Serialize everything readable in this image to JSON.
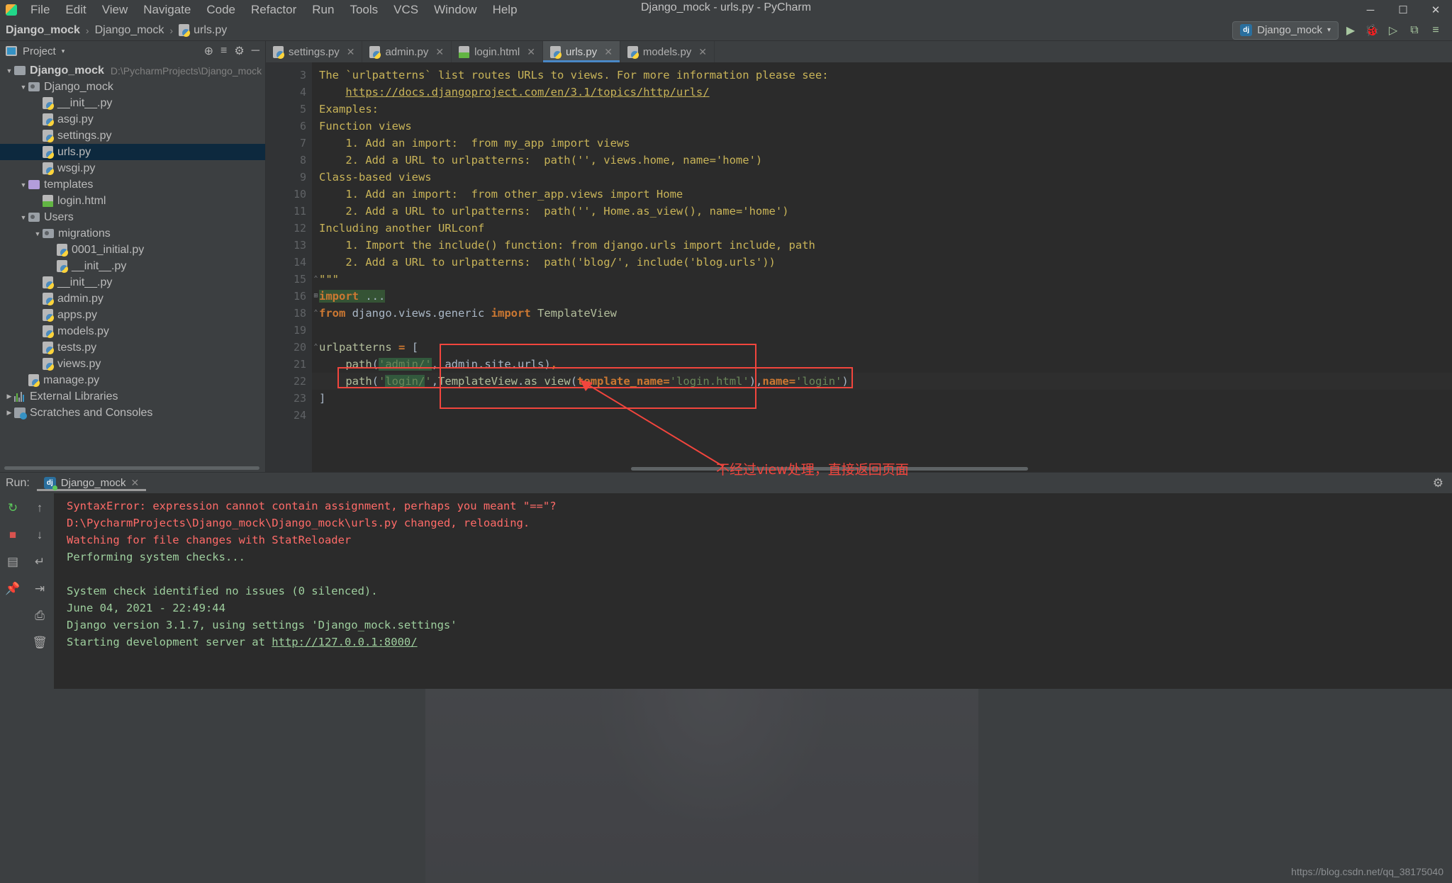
{
  "window": {
    "title": "Django_mock - urls.py - PyCharm",
    "minimize": "─",
    "maximize": "☐",
    "close": "✕"
  },
  "menu": {
    "items": [
      {
        "label": "File"
      },
      {
        "label": "Edit"
      },
      {
        "label": "View"
      },
      {
        "label": "Navigate"
      },
      {
        "label": "Code"
      },
      {
        "label": "Refactor"
      },
      {
        "label": "Run"
      },
      {
        "label": "Tools"
      },
      {
        "label": "VCS"
      },
      {
        "label": "Window"
      },
      {
        "label": "Help"
      }
    ]
  },
  "navbar": {
    "crumbs": [
      "Django_mock",
      "Django_mock",
      "urls.py"
    ],
    "separator": "›",
    "run_config": {
      "label": "Django_mock",
      "badge": "dj",
      "caret": "▾"
    },
    "buttons": [
      {
        "name": "run-button",
        "glyph": "▶"
      },
      {
        "name": "debug-button",
        "glyph": "🐞"
      },
      {
        "name": "run-coverage-button",
        "glyph": "▷"
      },
      {
        "name": "profile-button",
        "glyph": "⧉"
      },
      {
        "name": "attach-button",
        "glyph": "≡"
      }
    ]
  },
  "project_panel": {
    "title": "Project",
    "caret": "▾",
    "actions": [
      {
        "name": "locate-icon",
        "glyph": "⊕"
      },
      {
        "name": "collapse-all-icon",
        "glyph": "≡"
      },
      {
        "name": "settings-icon",
        "glyph": "⚙"
      },
      {
        "name": "hide-icon",
        "glyph": "─"
      }
    ],
    "tree": [
      {
        "indent": 0,
        "arrow": "▼",
        "icon": "folder",
        "label": "Django_mock",
        "bold": true,
        "path": "D:\\PycharmProjects\\Django_mock",
        "selected": false
      },
      {
        "indent": 1,
        "arrow": "▼",
        "icon": "folder-module",
        "label": "Django_mock",
        "bold": false,
        "path": "",
        "selected": false
      },
      {
        "indent": 2,
        "arrow": "",
        "icon": "python",
        "label": "__init__.py",
        "bold": false,
        "path": "",
        "selected": false
      },
      {
        "indent": 2,
        "arrow": "",
        "icon": "python",
        "label": "asgi.py",
        "bold": false,
        "path": "",
        "selected": false
      },
      {
        "indent": 2,
        "arrow": "",
        "icon": "python",
        "label": "settings.py",
        "bold": false,
        "path": "",
        "selected": false
      },
      {
        "indent": 2,
        "arrow": "",
        "icon": "python",
        "label": "urls.py",
        "bold": false,
        "path": "",
        "selected": true
      },
      {
        "indent": 2,
        "arrow": "",
        "icon": "python",
        "label": "wsgi.py",
        "bold": false,
        "path": "",
        "selected": false
      },
      {
        "indent": 1,
        "arrow": "▼",
        "icon": "folder-purple",
        "label": "templates",
        "bold": false,
        "path": "",
        "selected": false
      },
      {
        "indent": 2,
        "arrow": "",
        "icon": "html",
        "label": "login.html",
        "bold": false,
        "path": "",
        "selected": false
      },
      {
        "indent": 1,
        "arrow": "▼",
        "icon": "folder-module",
        "label": "Users",
        "bold": false,
        "path": "",
        "selected": false
      },
      {
        "indent": 2,
        "arrow": "▼",
        "icon": "folder-module",
        "label": "migrations",
        "bold": false,
        "path": "",
        "selected": false
      },
      {
        "indent": 3,
        "arrow": "",
        "icon": "python",
        "label": "0001_initial.py",
        "bold": false,
        "path": "",
        "selected": false
      },
      {
        "indent": 3,
        "arrow": "",
        "icon": "python",
        "label": "__init__.py",
        "bold": false,
        "path": "",
        "selected": false
      },
      {
        "indent": 2,
        "arrow": "",
        "icon": "python",
        "label": "__init__.py",
        "bold": false,
        "path": "",
        "selected": false
      },
      {
        "indent": 2,
        "arrow": "",
        "icon": "python",
        "label": "admin.py",
        "bold": false,
        "path": "",
        "selected": false
      },
      {
        "indent": 2,
        "arrow": "",
        "icon": "python",
        "label": "apps.py",
        "bold": false,
        "path": "",
        "selected": false
      },
      {
        "indent": 2,
        "arrow": "",
        "icon": "python",
        "label": "models.py",
        "bold": false,
        "path": "",
        "selected": false
      },
      {
        "indent": 2,
        "arrow": "",
        "icon": "python",
        "label": "tests.py",
        "bold": false,
        "path": "",
        "selected": false
      },
      {
        "indent": 2,
        "arrow": "",
        "icon": "python",
        "label": "views.py",
        "bold": false,
        "path": "",
        "selected": false
      },
      {
        "indent": 1,
        "arrow": "",
        "icon": "python",
        "label": "manage.py",
        "bold": false,
        "path": "",
        "selected": false
      },
      {
        "indent": 0,
        "arrow": "▶",
        "icon": "libraries",
        "label": "External Libraries",
        "bold": false,
        "path": "",
        "selected": false
      },
      {
        "indent": 0,
        "arrow": "▶",
        "icon": "scratches",
        "label": "Scratches and Consoles",
        "bold": false,
        "path": "",
        "selected": false
      }
    ]
  },
  "editor": {
    "tabs": [
      {
        "label": "settings.py",
        "icon": "python",
        "active": false,
        "close": "✕"
      },
      {
        "label": "admin.py",
        "icon": "python",
        "active": false,
        "close": "✕"
      },
      {
        "label": "login.html",
        "icon": "html",
        "active": false,
        "close": "✕"
      },
      {
        "label": "urls.py",
        "icon": "python",
        "active": true,
        "close": "✕"
      },
      {
        "label": "models.py",
        "icon": "python",
        "active": false,
        "close": "✕"
      }
    ],
    "line_numbers": [
      "3",
      "4",
      "5",
      "6",
      "7",
      "8",
      "9",
      "10",
      "11",
      "12",
      "13",
      "14",
      "15",
      "16",
      "18",
      "19",
      "20",
      "21",
      "22",
      "23",
      "24"
    ],
    "code_lines": [
      "The `urlpatterns` list routes URLs to views. For more information please see:",
      "    https://docs.djangoproject.com/en/3.1/topics/http/urls/",
      "Examples:",
      "Function views",
      "    1. Add an import:  from my_app import views",
      "    2. Add a URL to urlpatterns:  path('', views.home, name='home')",
      "Class-based views",
      "    1. Add an import:  from other_app.views import Home",
      "    2. Add a URL to urlpatterns:  path('', Home.as_view(), name='home')",
      "Including another URLconf",
      "    1. Import the include() function: from django.urls import include, path",
      "    2. Add a URL to urlpatterns:  path('blog/', include('blog.urls'))",
      "\"\"\"",
      "import ...",
      "from django.views.generic import TemplateView",
      "",
      "urlpatterns = [",
      "    path('admin/', admin.site.urls),",
      "    path('login/',TemplateView.as_view(template_name='login.html'),name='login')",
      "]",
      ""
    ],
    "docs_url": "https://docs.djangoproject.com/en/3.1/topics/http/urls/"
  },
  "annotation": {
    "text": "不经过view处理，直接返回页面",
    "color": "#f2453d"
  },
  "run_panel": {
    "label": "Run:",
    "tab_label": "Django_mock",
    "tab_badge": "dj",
    "tab_close": "✕",
    "gear": "⚙",
    "left_tools": [
      {
        "name": "rerun-icon",
        "glyph": "↻"
      },
      {
        "name": "stop-icon",
        "glyph": "■"
      },
      {
        "name": "layout-icon",
        "glyph": "▤"
      },
      {
        "name": "pin-icon",
        "glyph": "📌"
      }
    ],
    "right_tools": [
      {
        "name": "up-arrow-icon",
        "glyph": "↑"
      },
      {
        "name": "down-arrow-icon",
        "glyph": "↓"
      },
      {
        "name": "soft-wrap-icon",
        "glyph": "↵"
      },
      {
        "name": "scroll-end-icon",
        "glyph": "⇥"
      },
      {
        "name": "print-icon",
        "glyph": "⎙"
      },
      {
        "name": "trash-icon",
        "glyph": "🗑"
      }
    ],
    "console_lines": [
      {
        "text": "SyntaxError: expression cannot contain assignment, perhaps you meant \"==\"?",
        "color": "red"
      },
      {
        "text": "D:\\PycharmProjects\\Django_mock\\Django_mock\\urls.py changed, reloading.",
        "color": "red"
      },
      {
        "text": "Watching for file changes with StatReloader",
        "color": "red"
      },
      {
        "text": "Performing system checks...",
        "color": "green"
      },
      {
        "text": "",
        "color": "green"
      },
      {
        "text": "System check identified no issues (0 silenced).",
        "color": "green"
      },
      {
        "text": "June 04, 2021 - 22:49:44",
        "color": "green"
      },
      {
        "text": "Django version 3.1.7, using settings 'Django_mock.settings'",
        "color": "green"
      },
      {
        "text": "Starting development server at http://127.0.0.1:8000/",
        "color": "green"
      }
    ],
    "server_url": "http://127.0.0.1:8000/"
  },
  "watermark": "https://blog.csdn.net/qq_38175040"
}
